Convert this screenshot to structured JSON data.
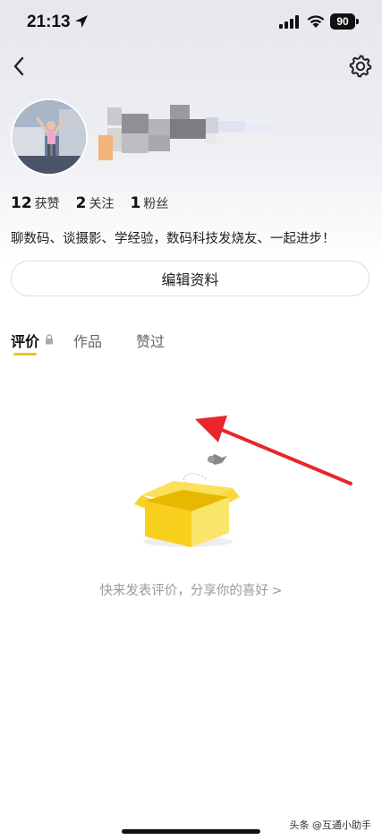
{
  "status_bar": {
    "time": "21:13",
    "battery": "90"
  },
  "icons": {
    "back": "chevron-left-icon",
    "settings": "gear-icon",
    "location": "location-arrow-icon",
    "lock": "lock-icon"
  },
  "profile": {
    "stats": [
      {
        "value": "12",
        "label": "获赞"
      },
      {
        "value": "2",
        "label": "关注"
      },
      {
        "value": "1",
        "label": "粉丝"
      }
    ],
    "bio": "聊数码、谈摄影、学经验，数码科技发烧友、一起进步！"
  },
  "edit_button_label": "编辑资料",
  "tabs": [
    {
      "label": "评价",
      "active": true
    },
    {
      "label": "作品",
      "active": false
    },
    {
      "label": "赞过",
      "active": false
    }
  ],
  "empty_state": {
    "message": "快来发表评价，分享你的喜好"
  },
  "watermark": "头条 @互通小助手",
  "colors": {
    "accent_yellow": "#f5c518",
    "arrow_red": "#e8262b",
    "muted_text": "#9a9a9a"
  }
}
